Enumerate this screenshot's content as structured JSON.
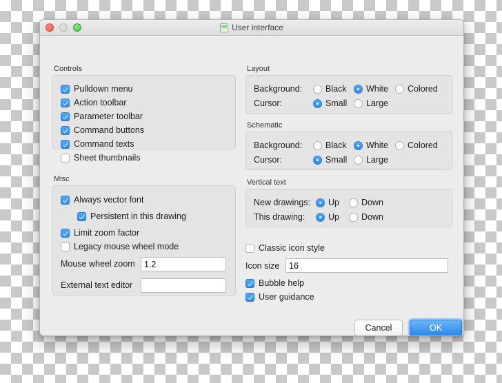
{
  "window": {
    "title": "User interface",
    "title_icon": "document-window-icon",
    "traffic_lights": {
      "close": "close-button",
      "minimize": "minimize-button",
      "zoom": "zoom-button"
    }
  },
  "controls": {
    "group_label": "Controls",
    "items": [
      {
        "label": "Pulldown menu",
        "checked": true
      },
      {
        "label": "Action toolbar",
        "checked": true
      },
      {
        "label": "Parameter toolbar",
        "checked": true
      },
      {
        "label": "Command buttons",
        "checked": true
      },
      {
        "label": "Command texts",
        "checked": true
      },
      {
        "label": "Sheet thumbnails",
        "checked": false
      }
    ]
  },
  "misc": {
    "group_label": "Misc",
    "items": [
      {
        "label": "Always vector font",
        "checked": true,
        "indented": false
      },
      {
        "label": "Persistent in this drawing",
        "checked": true,
        "indented": true
      },
      {
        "label": "Limit zoom factor",
        "checked": true,
        "indented": false
      },
      {
        "label": "Legacy mouse wheel mode",
        "checked": false,
        "indented": false
      }
    ],
    "mouse_wheel_zoom": {
      "label": "Mouse wheel zoom",
      "value": "1.2",
      "placeholder": ""
    },
    "external_text_editor": {
      "label": "External text editor",
      "value": "",
      "placeholder": ""
    }
  },
  "layout": {
    "group_label": "Layout",
    "background": {
      "label": "Background:",
      "options": [
        "Black",
        "White",
        "Colored"
      ],
      "selected": "White"
    },
    "cursor": {
      "label": "Cursor:",
      "options": [
        "Small",
        "Large"
      ],
      "selected": "Small"
    }
  },
  "schematic": {
    "group_label": "Schematic",
    "background": {
      "label": "Background:",
      "options": [
        "Black",
        "White",
        "Colored"
      ],
      "selected": "White"
    },
    "cursor": {
      "label": "Cursor:",
      "options": [
        "Small",
        "Large"
      ],
      "selected": "Small"
    }
  },
  "vertical_text": {
    "group_label": "Vertical text",
    "new_drawings": {
      "label": "New drawings:",
      "options": [
        "Up",
        "Down"
      ],
      "selected": "Up"
    },
    "this_drawing": {
      "label": "This drawing:",
      "options": [
        "Up",
        "Down"
      ],
      "selected": "Up"
    }
  },
  "icons": {
    "classic_icon_style": {
      "label": "Classic icon style",
      "checked": false
    },
    "icon_size": {
      "label": "Icon size",
      "value": "16",
      "placeholder": ""
    },
    "bubble_help": {
      "label": "Bubble help",
      "checked": true
    },
    "user_guidance": {
      "label": "User guidance",
      "checked": true
    }
  },
  "buttons": {
    "cancel": "Cancel",
    "ok": "OK"
  },
  "colors": {
    "accent": "#2f8cec",
    "window_bg": "#ececec",
    "group_bg": "#e4e4e4"
  }
}
